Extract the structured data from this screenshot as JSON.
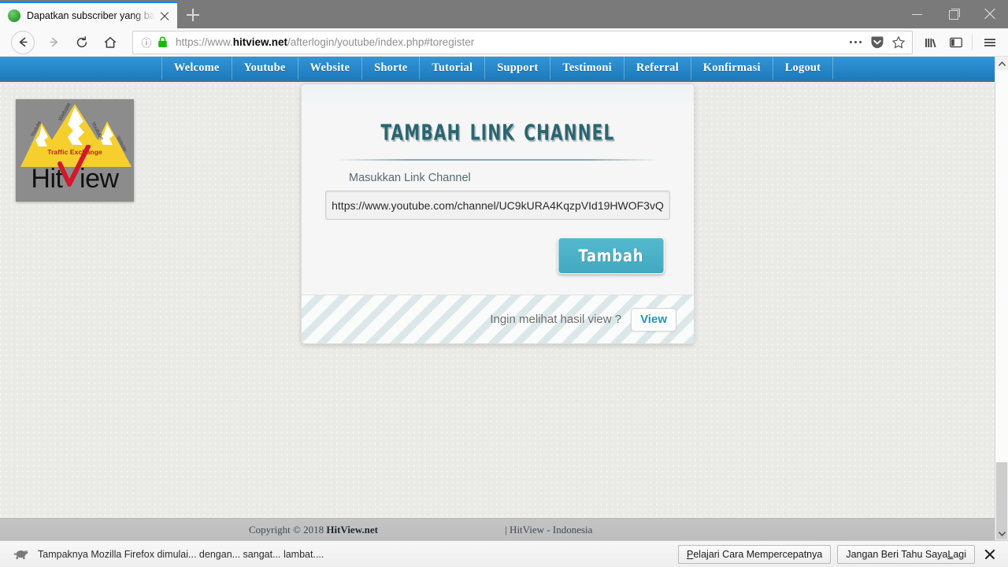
{
  "browser": {
    "tab": {
      "title": "Dapatkan subscriber yang bany",
      "favicon_name": "site-favicon",
      "close_label": "×"
    },
    "newtab_label": "+",
    "window_controls": {
      "minimize": "minimize-button",
      "maximize": "restore-button",
      "close": "close-button"
    },
    "nav": {
      "back": "←",
      "forward": "→",
      "reload": "⟳",
      "home": "⌂"
    },
    "url": {
      "scheme": "https://www.",
      "domain": "hitview.net",
      "path": "/afterlogin/youtube/index.php#toregister",
      "identity_icon": "ⓘ",
      "lock_icon": "lock-icon"
    },
    "url_actions": {
      "page_actions": "…",
      "pocket": "pocket-icon",
      "bookmark": "star-icon"
    },
    "toolbar_icons": {
      "library": "library-icon",
      "sidebar": "sidebar-icon",
      "menu": "hamburger-menu-icon"
    }
  },
  "site": {
    "nav_items": [
      {
        "label": "Welcome"
      },
      {
        "label": "Youtube"
      },
      {
        "label": "Website"
      },
      {
        "label": "Shorte"
      },
      {
        "label": "Tutorial"
      },
      {
        "label": "Support"
      },
      {
        "label": "Testimoni"
      },
      {
        "label": "Referral"
      },
      {
        "label": "Konfirmasi"
      },
      {
        "label": "Logout"
      }
    ],
    "logo": {
      "tagline": "Traffic Exchange",
      "wordmark_pre": "Hit",
      "wordmark_post": "iew",
      "check_color": "#d2182a",
      "mountain_color": "#f5cf2e",
      "plate_color": "#8c8c8c"
    },
    "card": {
      "title": "Tambah Link Channel",
      "field_label": "Masukkan Link Channel",
      "input_value": "https://www.youtube.com/channel/UC9kURA4KqzpVId19HWOF3vQ",
      "input_placeholder": "Masukkan Link Channel",
      "submit_label": "Tambah",
      "footer_question": "Ingin melihat hasil view ?",
      "footer_button": "View",
      "accent_color": "#4cb2c6",
      "title_color": "#2b6570"
    },
    "footer": {
      "copyright_pre": "Copyright © 2018 ",
      "brand": "HitView.net",
      "copyright_post": " | HitView - Indonesia"
    }
  },
  "notification": {
    "icon_name": "turtle-slow-icon",
    "message": "Tampaknya Mozilla Firefox dimulai... dengan... sangat... lambat....",
    "primary_button": "Pelajari Cara Mempercepatnya",
    "secondary_button": "Jangan Beri Tahu Saya Lagi",
    "close_label": "×"
  }
}
